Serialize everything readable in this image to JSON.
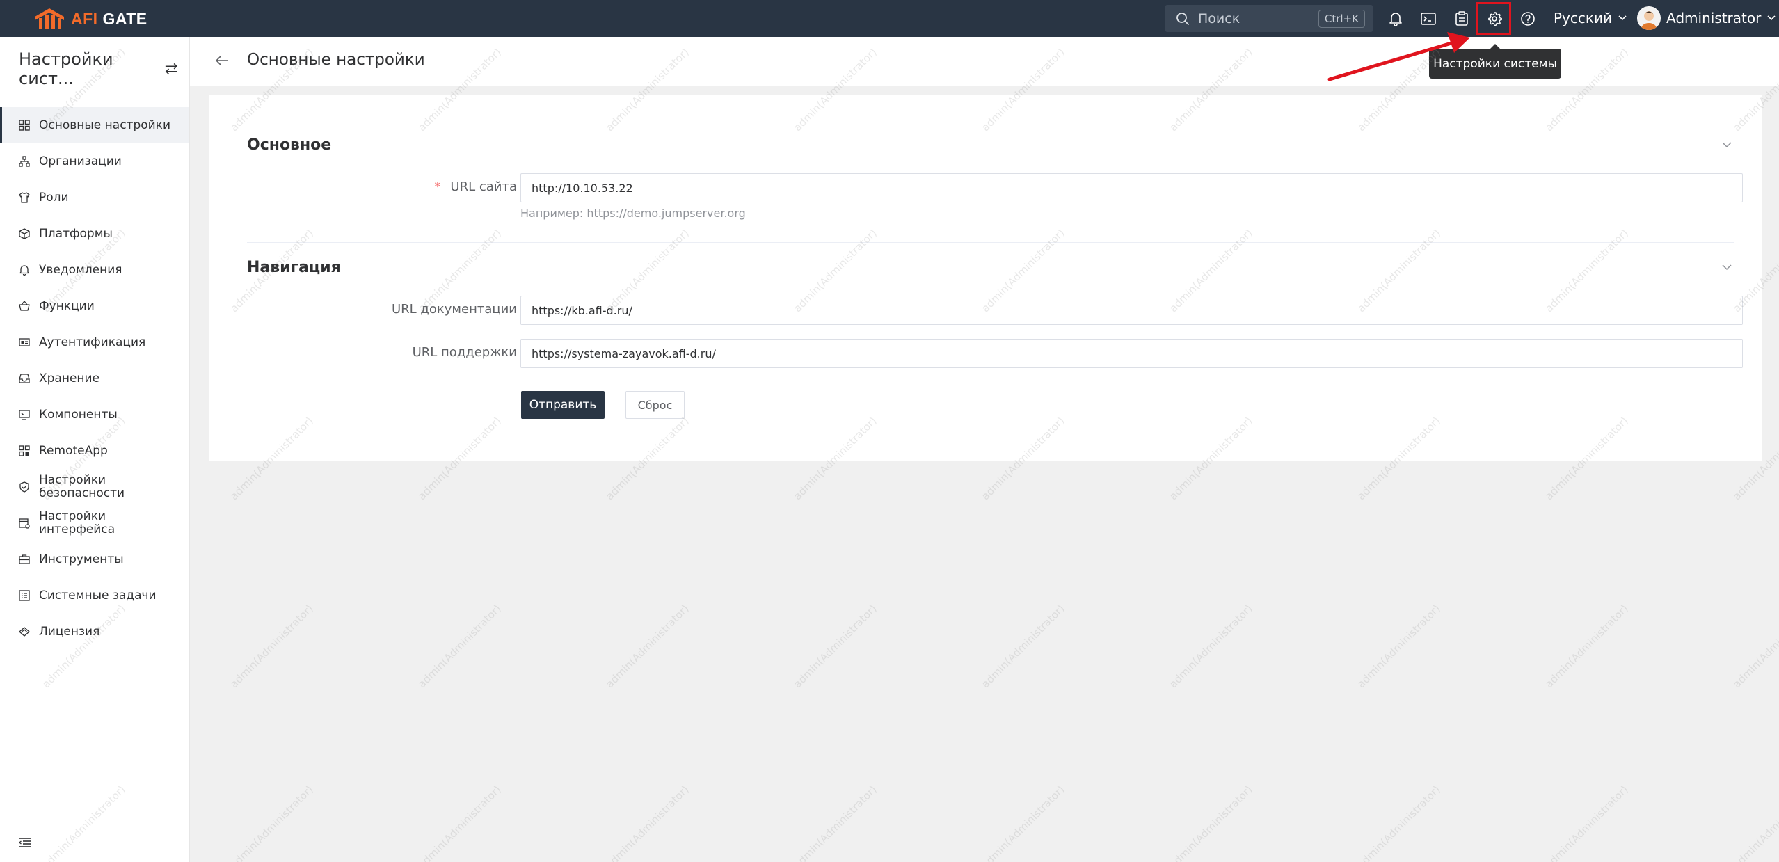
{
  "app": {
    "brand_prefix": "AFI",
    "brand_suffix": "GATE",
    "search_placeholder": "Поиск",
    "search_shortcut": "Ctrl+K",
    "language": "Русский",
    "user_name": "Administrator"
  },
  "tooltip": "Настройки системы",
  "sidebar": {
    "title": "Настройки сист...",
    "items": [
      {
        "label": "Основные настройки",
        "icon": "grid-icon",
        "active": true
      },
      {
        "label": "Организации",
        "icon": "org-tree-icon"
      },
      {
        "label": "Роли",
        "icon": "shirt-icon"
      },
      {
        "label": "Платформы",
        "icon": "cube-icon"
      },
      {
        "label": "Уведомления",
        "icon": "bell-icon"
      },
      {
        "label": "Функции",
        "icon": "basket-icon"
      },
      {
        "label": "Аутентификация",
        "icon": "id-card-icon"
      },
      {
        "label": "Хранение",
        "icon": "inbox-icon"
      },
      {
        "label": "Компоненты",
        "icon": "monitor-icon"
      },
      {
        "label": "RemoteApp",
        "icon": "apps-icon"
      },
      {
        "label": "Настройки безопасности",
        "icon": "shield-check-icon"
      },
      {
        "label": "Настройки интерфейса",
        "icon": "interface-icon"
      },
      {
        "label": "Инструменты",
        "icon": "toolbox-icon"
      },
      {
        "label": "Системные задачи",
        "icon": "task-list-icon"
      },
      {
        "label": "Лицензия",
        "icon": "diamond-icon"
      }
    ]
  },
  "page": {
    "title": "Основные настройки"
  },
  "form": {
    "section_basic": "Основное",
    "site_url_label": "URL сайта",
    "site_url_value": "http://10.10.53.22",
    "site_url_hint": "Например: https://demo.jumpserver.org",
    "section_nav": "Навигация",
    "docs_url_label": "URL документации",
    "docs_url_value": "https://kb.afi-d.ru/",
    "support_url_label": "URL поддержки",
    "support_url_value": "https://systema-zayavok.afi-d.ru/",
    "submit_label": "Отправить",
    "reset_label": "Сброс"
  },
  "watermark_text": "admin(Administrator)",
  "colors": {
    "topbar": "#293544",
    "accent": "#f26b2a",
    "highlight": "#e0141e"
  }
}
